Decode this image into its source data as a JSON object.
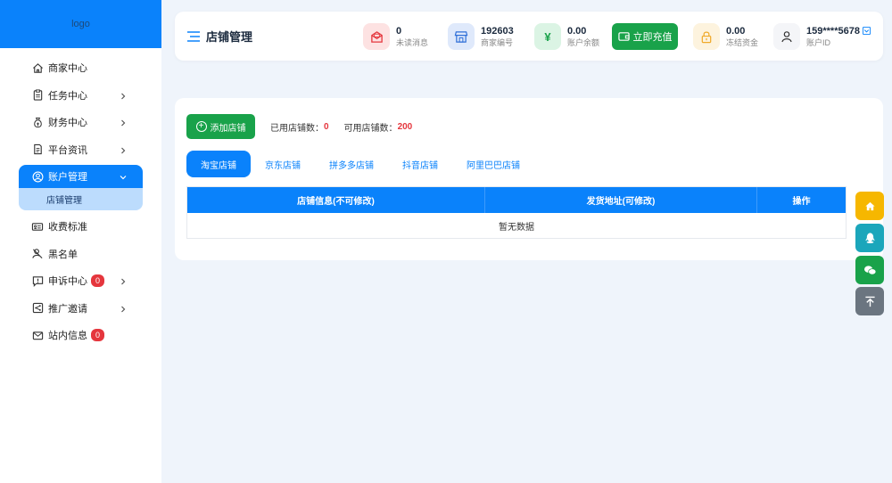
{
  "sidebar": {
    "logo": "logo",
    "items": [
      {
        "label": "商家中心",
        "icon": "home-icon"
      },
      {
        "label": "任务中心",
        "icon": "clipboard-icon"
      },
      {
        "label": "财务中心",
        "icon": "moneybag-icon"
      },
      {
        "label": "平台资讯",
        "icon": "document-icon"
      },
      {
        "label": "账户管理",
        "icon": "user-circle-icon"
      },
      {
        "label": "店铺管理"
      },
      {
        "label": "收费标准",
        "icon": "id-card-icon"
      },
      {
        "label": "黑名单",
        "icon": "user-blocked-icon"
      },
      {
        "label": "申诉中心",
        "icon": "alert-message-icon",
        "badge": "0"
      },
      {
        "label": "推广邀请",
        "icon": "share-icon"
      },
      {
        "label": "站内信息",
        "icon": "mail-icon",
        "badge": "0"
      }
    ]
  },
  "header": {
    "title": "店铺管理",
    "stats": [
      {
        "value": "0",
        "label": "未读消息",
        "icon": "mail-open-icon"
      },
      {
        "value": "192603",
        "label": "商家编号",
        "icon": "shop-icon"
      },
      {
        "value": "0.00",
        "label": "账户余额",
        "icon": "yen-icon"
      },
      {
        "value": "0.00",
        "label": "冻结资金",
        "icon": "lock-icon"
      },
      {
        "value": "159****5678",
        "label": "账户ID",
        "icon": "user-icon"
      }
    ],
    "recharge_label": "立即充值",
    "yen_glyph": "¥"
  },
  "main": {
    "add_label": "添加店铺",
    "used_label": "已用店铺数：",
    "used_value": "0",
    "avail_label": "可用店铺数：",
    "avail_value": "200",
    "tabs": [
      "淘宝店铺",
      "京东店铺",
      "拼多多店铺",
      "抖音店铺",
      "阿里巴巴店铺"
    ],
    "columns": [
      "店铺信息(不可修改)",
      "发货地址(可修改)",
      "操作"
    ],
    "empty_text": "暂无数据"
  },
  "colors": {
    "primary": "#0a82fb",
    "success": "#19a24a",
    "danger": "#e5363d"
  }
}
